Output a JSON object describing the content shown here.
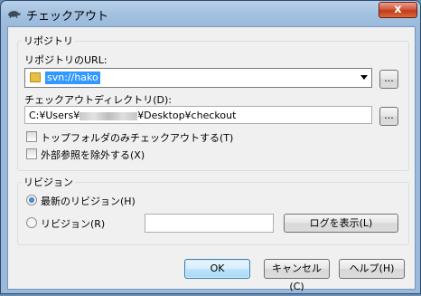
{
  "window": {
    "title": "チェックアウト",
    "close_glyph": "x"
  },
  "repository_group": {
    "legend": "リポジトリ",
    "url_label": "リポジトリのURL:",
    "url_value": "svn://hako",
    "browse_glyph": "...",
    "dir_label": "チェックアウトディレクトリ(D):",
    "dir_prefix": "C:¥Users¥",
    "dir_suffix": "¥Desktop¥checkout",
    "dir_browse_glyph": "...",
    "top_folder_only": "トップフォルダのみチェックアウトする(T)",
    "omit_externals": "外部参照を除外する(X)"
  },
  "revision_group": {
    "legend": "リビジョン",
    "head_label": "最新のリビジョン(H)",
    "revision_label": "リビジョン(R)",
    "revision_value": "",
    "show_log_label": "ログを表示(L)"
  },
  "buttons": {
    "ok": "OK",
    "cancel": "キャンセル(C)",
    "help": "ヘルプ(H)"
  },
  "colors": {
    "title_bar": "#a3c1e0",
    "close_button": "#c23a18",
    "selection": "#3399ff"
  }
}
